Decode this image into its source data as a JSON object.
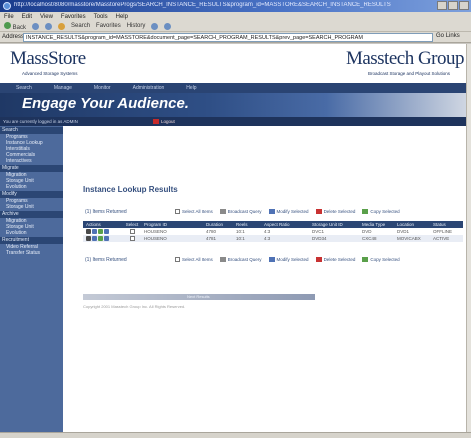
{
  "browser": {
    "title": "http://localhost/8080/masstore/MasstoreProgs/SEARCH_INSTANCE_RESULTS&program_id=MASSTORE&SEARCH_INSTANCE_RESULTS",
    "menu": [
      "File",
      "Edit",
      "View",
      "Favorites",
      "Tools",
      "Help"
    ],
    "toolbar": [
      "Back",
      "Search",
      "Favorites",
      "History"
    ],
    "address_label": "Address",
    "address_value": "INSTANCE_RESULTS&program_id=MASSTORE&document_page=SEARCH_PROGRAM_RESULTS&prev_page=SEARCH_PROGRAM",
    "go_label": "Go",
    "links_label": "Links"
  },
  "site": {
    "logo_left": "MassStore",
    "logo_left_sub": "Advanced Storage Systems",
    "logo_right": "Masstech Group",
    "logo_right_sub": "Broadcast Storage and Playout Solutions",
    "nav": [
      "Search",
      "Manage",
      "Monitor",
      "Administration",
      "Help"
    ],
    "tagline": "Engage Your Audience.",
    "user_text": "You are currently logged in as ADMIN",
    "logout_label": "Logout"
  },
  "sidebar": {
    "sections": [
      {
        "heading": "Search",
        "items": [
          "Programs",
          "Instance Lookup",
          "Interstitials",
          "Commercials",
          "Interactives"
        ]
      },
      {
        "heading": "Migrate",
        "items": [
          "Migration",
          "Storage Unit",
          "Evolution"
        ]
      },
      {
        "heading": "Modify",
        "items": [
          "Programs",
          "Storage Unit"
        ]
      },
      {
        "heading": "Archive",
        "items": [
          "Migration",
          "Storage Unit",
          "Evolution"
        ]
      },
      {
        "heading": "Recruitment",
        "items": [
          "Video Referral",
          "Transfer Status"
        ]
      }
    ]
  },
  "main": {
    "title": "Instance Lookup Results",
    "count_text": "(1) Items Returned",
    "count_text_bottom": "(1) Items Returned",
    "actions": {
      "select_all": "Select All Items",
      "broadcast": "Broadcast Query",
      "modify": "Modify Selected",
      "delete": "Delete Selected",
      "copy": "Copy Selected"
    },
    "columns": [
      "Actions",
      "Select",
      "Program ID",
      "Duration",
      "Reels",
      "Aspect Ratio",
      "Storage Unit ID",
      "Media Type",
      "Location",
      "Status"
    ],
    "rows": [
      [
        "",
        "",
        "HOUSENO",
        "4780",
        "10:1",
        "4:3",
        "DVC1",
        "DVD",
        "DVD1",
        "OFFLINE"
      ],
      [
        "",
        "",
        "HOUSENO",
        "4781",
        "10:1",
        "4:3",
        "DVD34",
        "CXC48",
        "MOVICABX",
        "ACTIVE"
      ]
    ],
    "bottom_bar_label": "Next Results",
    "footer": "Copyright 2001 Masstech Group Inc. All Rights Reserved."
  }
}
